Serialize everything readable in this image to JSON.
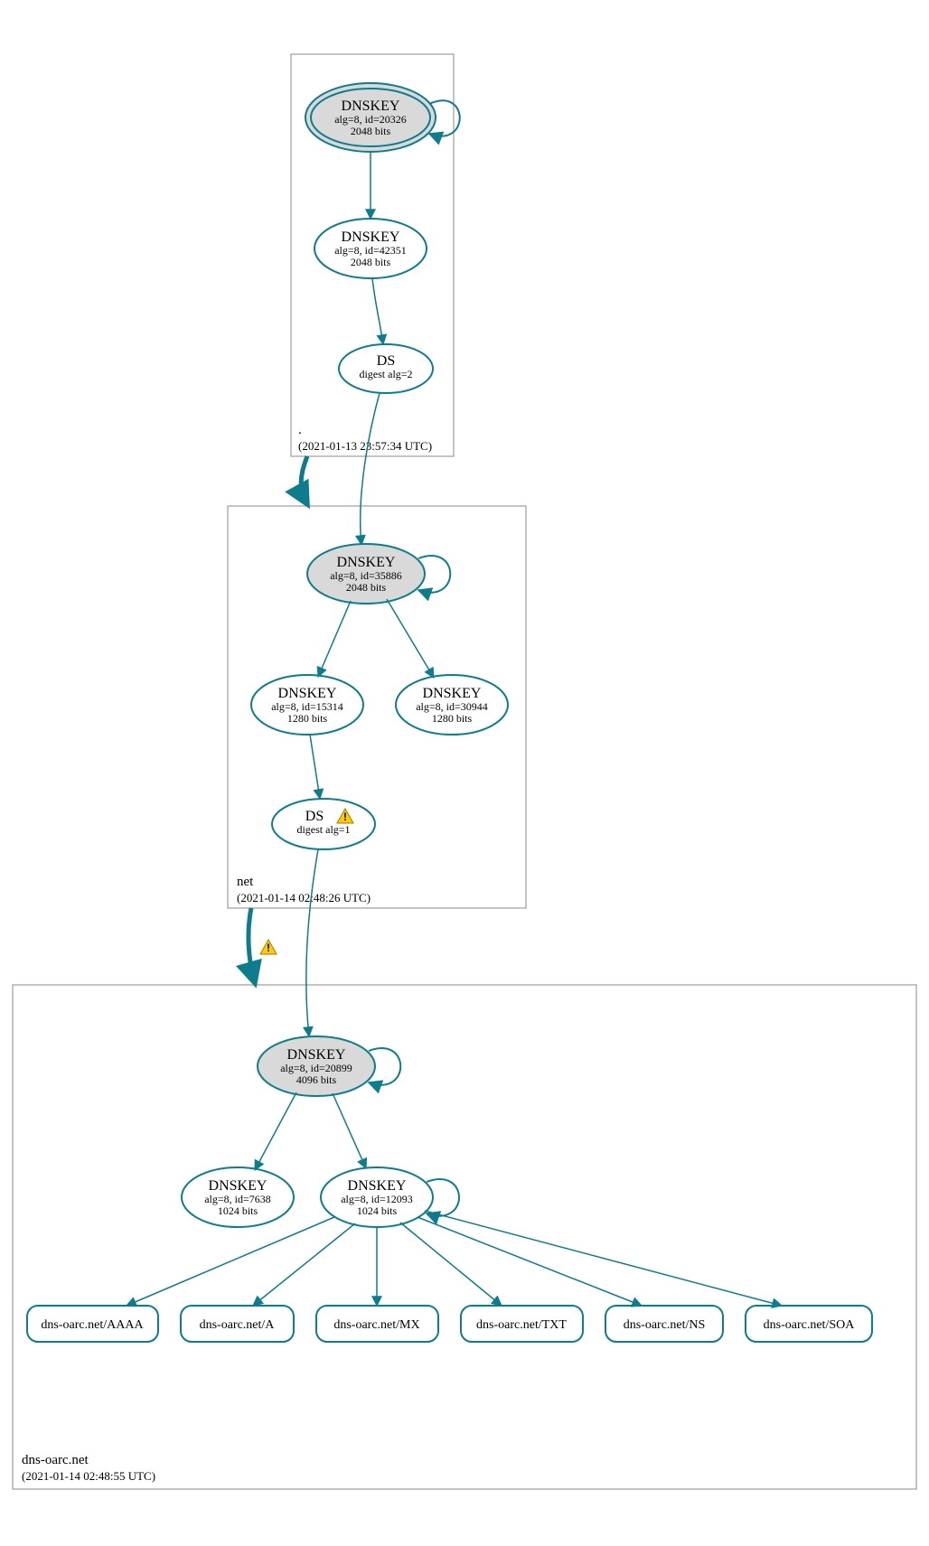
{
  "colors": {
    "teal": "#0d7c8c",
    "grey": "#d9d9d9",
    "white": "#ffffff",
    "box": "#888888"
  },
  "zones": [
    {
      "id": "root",
      "name": ".",
      "timestamp": "(2021-01-13 23:57:34 UTC)"
    },
    {
      "id": "net",
      "name": "net",
      "timestamp": "(2021-01-14 02:48:26 UTC)"
    },
    {
      "id": "dnsoarc",
      "name": "dns-oarc.net",
      "timestamp": "(2021-01-14 02:48:55 UTC)"
    }
  ],
  "nodes": {
    "root_ksk": {
      "title": "DNSKEY",
      "line1": "alg=8, id=20326",
      "line2": "2048 bits"
    },
    "root_zsk": {
      "title": "DNSKEY",
      "line1": "alg=8, id=42351",
      "line2": "2048 bits"
    },
    "root_ds": {
      "title": "DS",
      "line1": "digest alg=2"
    },
    "net_ksk": {
      "title": "DNSKEY",
      "line1": "alg=8, id=35886",
      "line2": "2048 bits"
    },
    "net_zsk1": {
      "title": "DNSKEY",
      "line1": "alg=8, id=15314",
      "line2": "1280 bits"
    },
    "net_zsk2": {
      "title": "DNSKEY",
      "line1": "alg=8, id=30944",
      "line2": "1280 bits"
    },
    "net_ds": {
      "title": "DS",
      "line1": "digest alg=1",
      "warn": true
    },
    "do_ksk": {
      "title": "DNSKEY",
      "line1": "alg=8, id=20899",
      "line2": "4096 bits"
    },
    "do_zsk1": {
      "title": "DNSKEY",
      "line1": "alg=8, id=7638",
      "line2": "1024 bits"
    },
    "do_zsk2": {
      "title": "DNSKEY",
      "line1": "alg=8, id=12093",
      "line2": "1024 bits"
    }
  },
  "rrsets": [
    {
      "id": "aaaa",
      "label": "dns-oarc.net/AAAA"
    },
    {
      "id": "a",
      "label": "dns-oarc.net/A"
    },
    {
      "id": "mx",
      "label": "dns-oarc.net/MX"
    },
    {
      "id": "txt",
      "label": "dns-oarc.net/TXT"
    },
    {
      "id": "ns",
      "label": "dns-oarc.net/NS"
    },
    {
      "id": "soa",
      "label": "dns-oarc.net/SOA"
    }
  ],
  "warn_edge": true
}
